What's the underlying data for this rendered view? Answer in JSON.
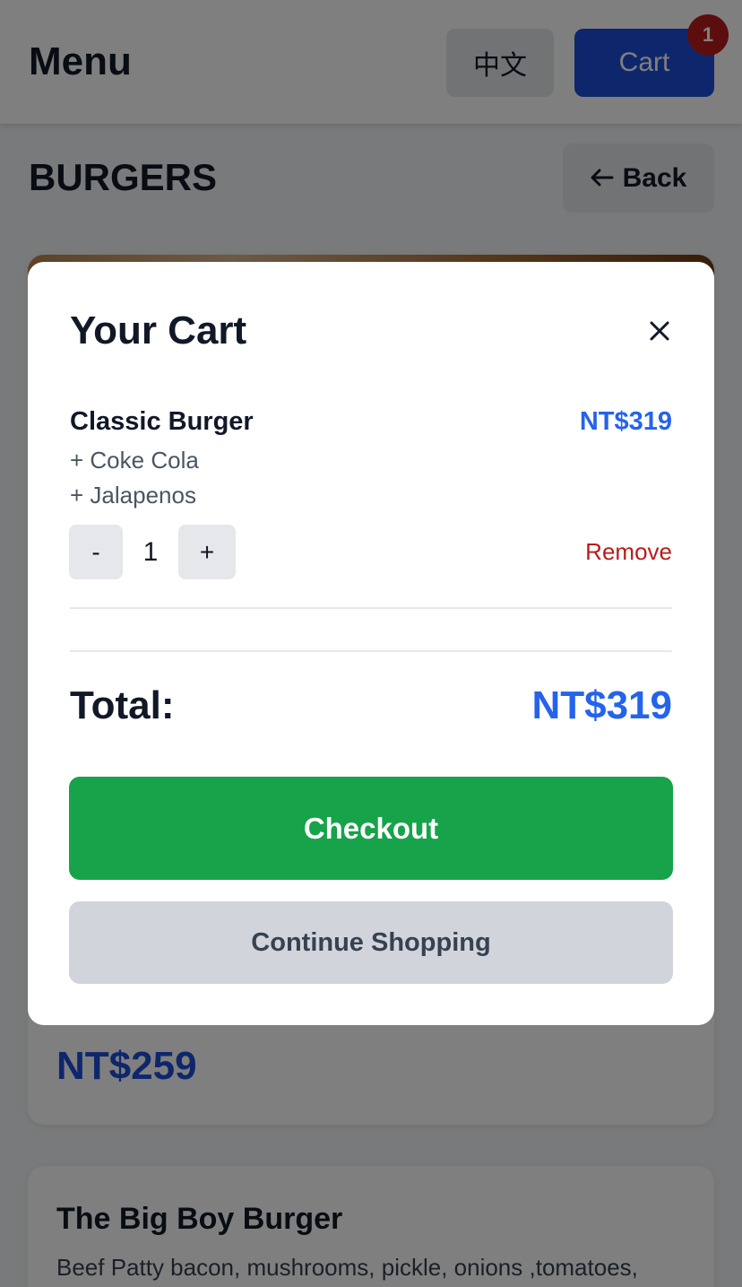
{
  "header": {
    "title": "Menu",
    "language_label": "中文",
    "cart_label": "Cart",
    "cart_count": "1"
  },
  "section": {
    "title": "BURGERS",
    "back_label": "Back",
    "back_icon": "arrow-left-icon"
  },
  "products": [
    {
      "price": "NT$259"
    },
    {
      "name": "The Big Boy Burger",
      "description": "Beef Patty bacon, mushrooms, pickle, onions ,tomatoes,"
    }
  ],
  "cart_modal": {
    "title": "Your Cart",
    "close_icon": "close-icon",
    "items": [
      {
        "name": "Classic Burger",
        "price": "NT$319",
        "addons": [
          "+ Coke Cola",
          "+ Jalapenos"
        ],
        "quantity": "1",
        "decrement_label": "-",
        "increment_label": "+",
        "remove_label": "Remove"
      }
    ],
    "total_label": "Total:",
    "total_value": "NT$319",
    "checkout_label": "Checkout",
    "continue_label": "Continue Shopping"
  },
  "colors": {
    "primary": "#1d4ed8",
    "price": "#2563eb",
    "checkout": "#16a34a",
    "remove": "#b91c1c",
    "badge": "#b91c1c"
  }
}
